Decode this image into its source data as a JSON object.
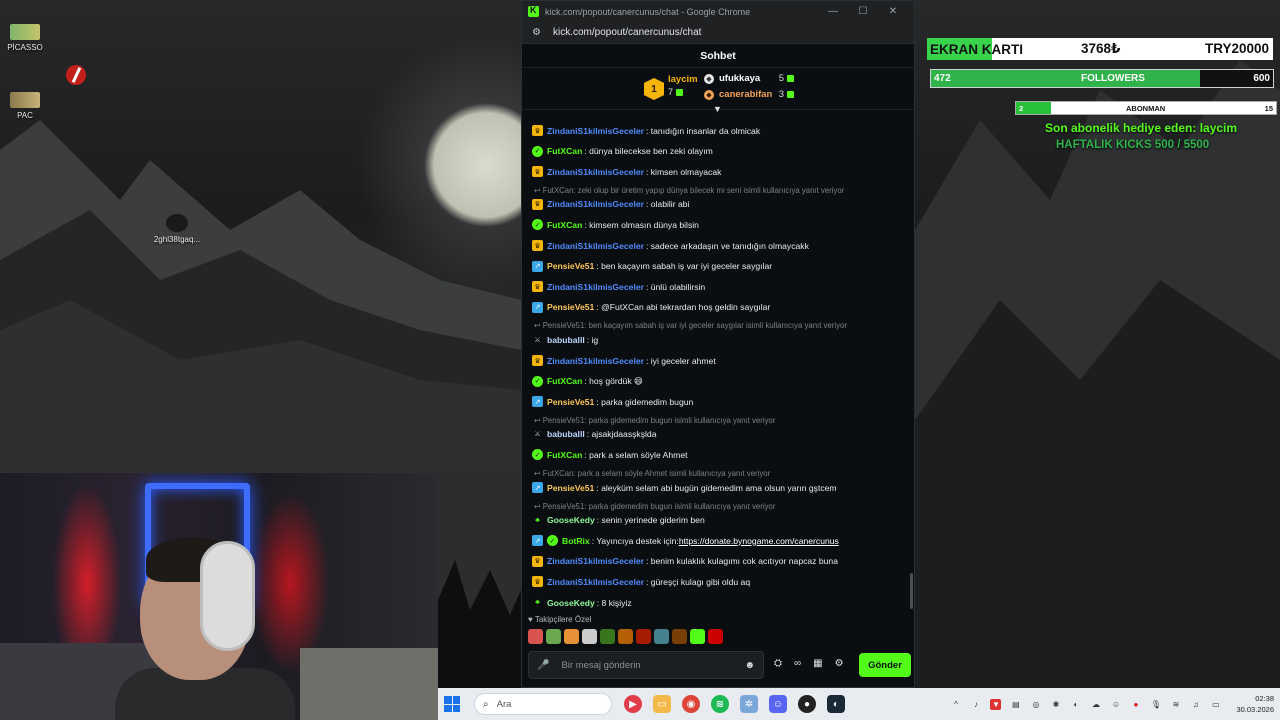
{
  "desktop": {
    "icons": [
      {
        "label": "PİCASSO"
      },
      {
        "label": "PAC"
      },
      {
        "label": "2ghl38tgaq..."
      }
    ]
  },
  "window": {
    "title": "kick.com/popout/canercunus/chat - Google Chrome",
    "url": "kick.com/popout/canercunus/chat",
    "minimize_icon": "minimize-icon",
    "maximize_icon": "maximize-icon",
    "close_icon": "close-icon"
  },
  "chat": {
    "header": "Sohbet",
    "leaderboard": [
      {
        "rank": "1",
        "name": "laycim",
        "count": "7",
        "color": "#f5b50a"
      },
      {
        "rank": "2",
        "name": "ufukkaya",
        "count": "5",
        "color": "#ffffff"
      },
      {
        "rank": "3",
        "name": "canerabifan",
        "count": "3",
        "color": "#f4a35a"
      }
    ],
    "messages": [
      {
        "badge": "crown",
        "user": "ZindaniS1kilmisGeceler",
        "ucls": "u-blue",
        "text": ": tanıdığın insanlar da olmicak"
      },
      {
        "badge": "vip",
        "user": "FutXCan",
        "ucls": "u-green",
        "text": ": dünya bilecekse ben zeki olayım"
      },
      {
        "badge": "crown",
        "user": "ZindaniS1kilmisGeceler",
        "ucls": "u-blue",
        "text": ": kimsen olmayacak"
      },
      {
        "reply": "FutXCan: zeki olup bir üretim yapıp dünya bilecek mi seni isimli kullanıcıya yanıt veriyor"
      },
      {
        "badge": "crown",
        "user": "ZindaniS1kilmisGeceler",
        "ucls": "u-blue",
        "text": ": olabilir abi"
      },
      {
        "badge": "vip",
        "user": "FutXCan",
        "ucls": "u-green",
        "text": ": kimsem olmasın dünya bilsin"
      },
      {
        "badge": "crown",
        "user": "ZindaniS1kilmisGeceler",
        "ucls": "u-blue",
        "text": ": sadece arkadaşın ve tanıdığın olmaycakk"
      },
      {
        "badge": "gift",
        "user": "PensieVe51",
        "ucls": "u-orange",
        "text": ": ben kaçayım sabah iş var iyi geceler saygılar"
      },
      {
        "badge": "crown",
        "user": "ZindaniS1kilmisGeceler",
        "ucls": "u-blue",
        "text": ": ünlü olabilirsin"
      },
      {
        "badge": "gift",
        "user": "PensieVe51",
        "ucls": "u-orange",
        "text": ": @FutXCan abi tekrardan hoş geldin saygılar"
      },
      {
        "reply": "PensieVe51: ben kaçayım sabah iş var iyi geceler saygılar isimli kullanıcıya yanıt veriyor"
      },
      {
        "badge": "sword",
        "user": "babuballl",
        "ucls": "u-lblue",
        "text": ": ig"
      },
      {
        "badge": "crown",
        "user": "ZindaniS1kilmisGeceler",
        "ucls": "u-blue",
        "text": ": iyi geceler ahmet"
      },
      {
        "badge": "vip",
        "user": "FutXCan",
        "ucls": "u-green",
        "text": ": hoş gördük 😄"
      },
      {
        "badge": "gift",
        "user": "PensieVe51",
        "ucls": "u-orange",
        "text": ": parka gidemedim bugun"
      },
      {
        "reply": "PensieVe51: parka gidemedim bugun isimli kullanıcıya yanıt veriyor"
      },
      {
        "badge": "sword",
        "user": "babuballl",
        "ucls": "u-lblue",
        "text": ": ajsakjdaasşkşlda"
      },
      {
        "badge": "vip",
        "user": "FutXCan",
        "ucls": "u-green",
        "text": ": park a selam söyle Ahmet"
      },
      {
        "reply": "FutXCan: park a selam söyle Ahmet isimli kullanıcıya yanıt veriyor"
      },
      {
        "badge": "gift",
        "user": "PensieVe51",
        "ucls": "u-orange",
        "text": ": aleyküm selam abi bugün gidemedim ama olsun yarın gştcem"
      },
      {
        "reply": "PensieVe51: parka gidemedim bugun isimli kullanıcıya yanıt veriyor"
      },
      {
        "badge": "leaf",
        "user": "GooseKedy",
        "ucls": "u-mint",
        "text": ": senin yerinede giderim ben"
      },
      {
        "badge": "botrix",
        "user": "BotRix",
        "ucls": "u-teal",
        "text": ": Yayıncıya destek için: ",
        "link": "https://donate.bynogame.com/canercunus"
      },
      {
        "badge": "crown",
        "user": "ZindaniS1kilmisGeceler",
        "ucls": "u-blue",
        "text": ": benim kulaklık kulagımı cok acıtıyor napcaz buna"
      },
      {
        "badge": "crown",
        "user": "ZindaniS1kilmisGeceler",
        "ucls": "u-blue",
        "text": ": güreşçi kulagı gibi oldu aq"
      },
      {
        "badge": "leaf",
        "user": "GooseKedy",
        "ucls": "u-mint",
        "text": ": 8 kişiyiz"
      }
    ],
    "followers_only": "♥ Takipçilere Özel",
    "emote_colors": [
      "#d9534f",
      "#6aa84f",
      "#e69138",
      "#cccccc",
      "#38761d",
      "#b45f06",
      "#a61c00",
      "#45818e",
      "#783f04",
      "#53fc18",
      "#cc0000"
    ],
    "input_placeholder": "Bir mesaj gönderin",
    "send_label": "Gönder"
  },
  "overlay": {
    "ekran_label": "EKRAN KARTI",
    "ekran_amount": "3768₺",
    "ekran_goal": "TRY20000",
    "ekran_progress": 0.1884,
    "followers_label": "FOLLOWERS",
    "followers_current": "472",
    "followers_goal": "600",
    "followers_progress": 0.7867,
    "abonman_label": "ABONMAN",
    "abonman_current": "2",
    "abonman_goal": "15",
    "abonman_progress": 0.1333,
    "gift_text": "Son abonelik hediye eden: laycim",
    "weekly_text": "HAFTALIK KICKS 500 / 5500"
  },
  "taskbar": {
    "search_placeholder": "Ara",
    "time": "02:38",
    "date": "30.03.2026"
  }
}
